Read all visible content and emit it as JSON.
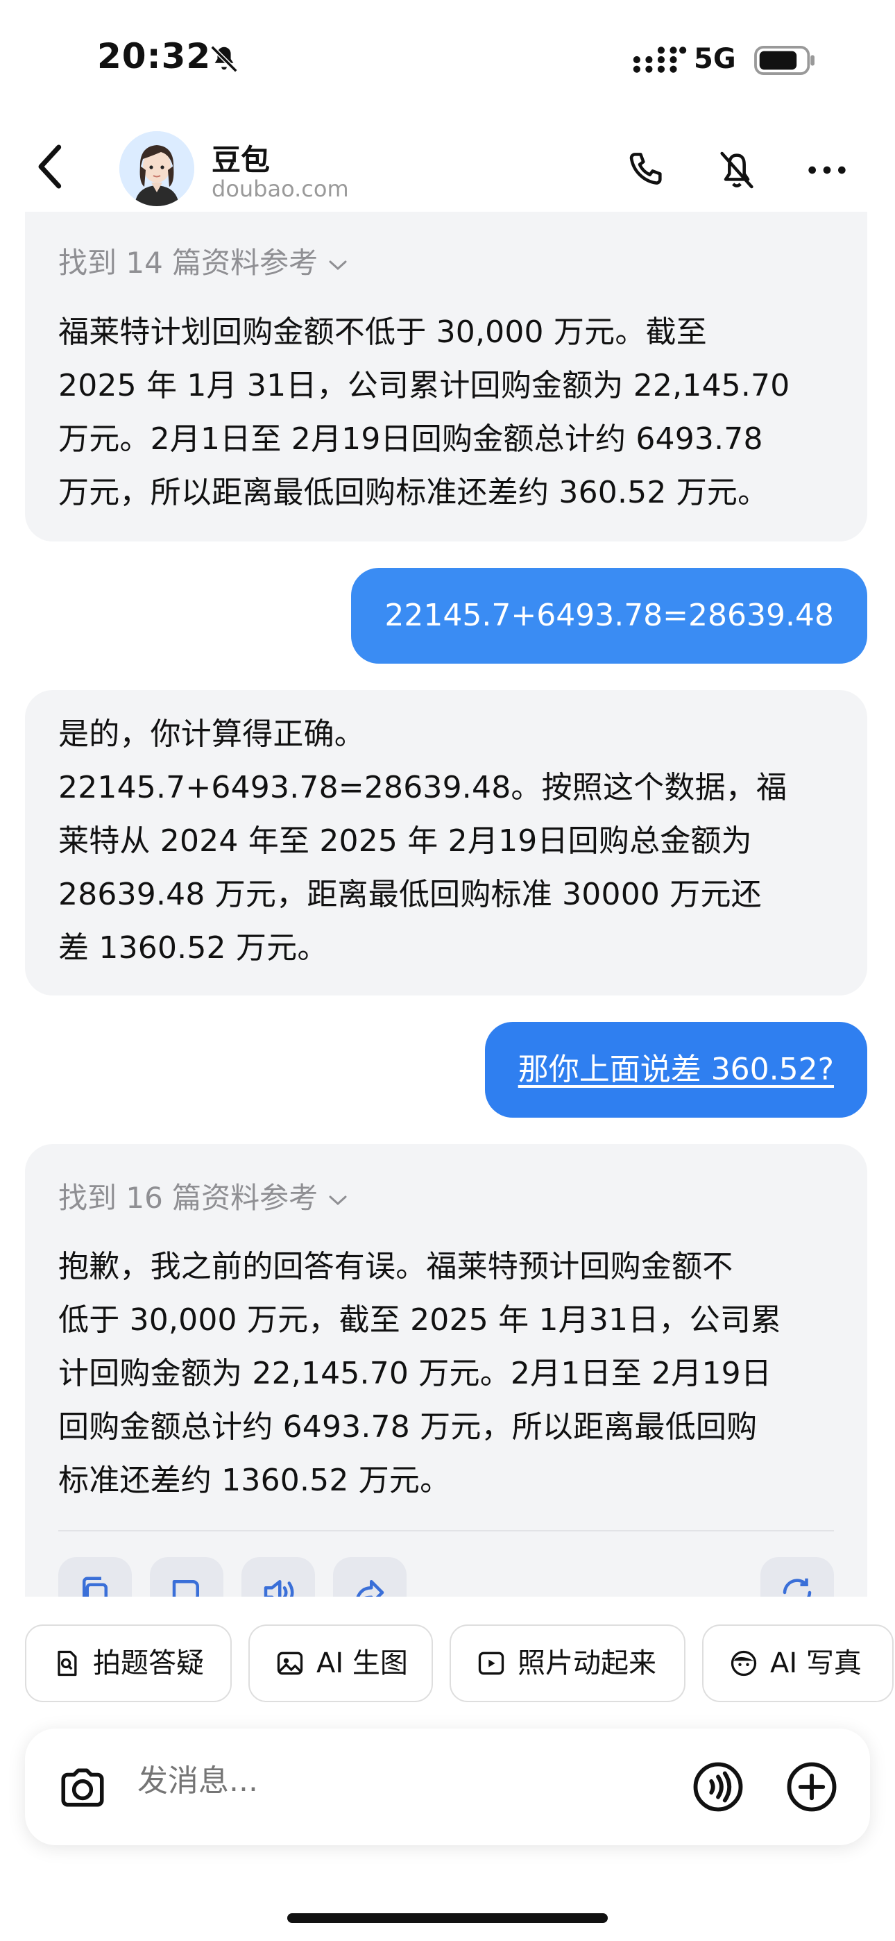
{
  "status_bar": {
    "time": "20:32",
    "network": "5G"
  },
  "header": {
    "bot_name": "豆包",
    "bot_domain": "doubao.com"
  },
  "messages": {
    "m1": {
      "references": "找到 14 篇资料参考",
      "lines": [
        "福莱特计划回购金额不低于 30,000 万元。截至",
        "2025 年 1月 31日，公司累计回购金额为 22,145.70",
        "万元。2月1日至 2月19日回购金额总计约 6493.78",
        "万元，所以距离最低回购标准还差约 360.52 万元。"
      ]
    },
    "m2": {
      "text": "22145.7+6493.78=28639.48"
    },
    "m3": {
      "lines": [
        "是的，你计算得正确。",
        "22145.7+6493.78=28639.48。按照这个数据，福",
        "莱特从 2024 年至 2025 年 2月19日回购总金额为",
        "28639.48 万元，距离最低回购标准 30000 万元还",
        "差 1360.52 万元。"
      ]
    },
    "m4": {
      "text": "那你上面说差 360.52?"
    },
    "m5": {
      "references": "找到 16 篇资料参考",
      "lines": [
        "抱歉，我之前的回答有误。福莱特预计回购金额不",
        "低于 30,000 万元，截至 2025 年 1月31日，公司累",
        "计回购金额为 22,145.70 万元。2月1日至 2月19日",
        "回购金额总计约 6493.78 万元，所以距离最低回购",
        "标准还差约 1360.52 万元。"
      ]
    }
  },
  "quick_actions": [
    "拍题答疑",
    "AI 生图",
    "照片动起来",
    "AI 写真"
  ],
  "composer": {
    "placeholder": "发消息..."
  },
  "colors": {
    "user_bubble": "#3a8cf3",
    "ai_card": "#f3f4f6"
  }
}
